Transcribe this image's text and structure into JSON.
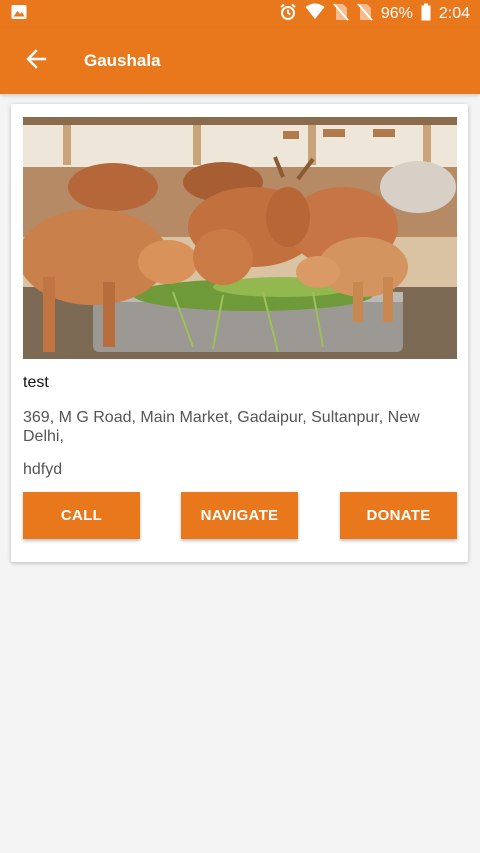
{
  "status_bar": {
    "battery_percent": "96%",
    "time": "2:04",
    "icons": [
      "image-icon",
      "alarm-icon",
      "wifi-icon",
      "no-sim-icon",
      "no-sim-icon",
      "battery-icon"
    ]
  },
  "app_bar": {
    "title": "Gaushala",
    "back_icon": "arrow-left-icon"
  },
  "card": {
    "name": "test",
    "address": "369, M G Road, Main Market, Gadaipur, Sultanpur, New Delhi,",
    "description": "hdfyd",
    "buttons": {
      "call": "CALL",
      "navigate": "NAVIGATE",
      "donate": "DONATE"
    }
  },
  "colors": {
    "primary": "#e9781d",
    "background": "#f4f4f4",
    "card": "#ffffff"
  }
}
